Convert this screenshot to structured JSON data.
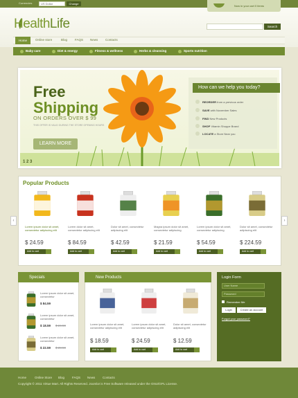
{
  "topbar": {
    "currencies_label": "Currencies",
    "currency_value": "US Dollar",
    "change_label": "Change",
    "cart_text": "Now in your cart 0 items"
  },
  "header": {
    "logo_part1": "Health",
    "logo_part2": "Life",
    "search_label": "Search"
  },
  "nav": [
    "Home",
    "Online store",
    "Blog",
    "FAQS",
    "News",
    "Contacts"
  ],
  "categories": [
    "Baby care",
    "Diet & energy",
    "Fitness & wellness",
    "Herbs & cleansing",
    "Sports nutrition"
  ],
  "banner": {
    "title1": "Free",
    "title2": "Shipping",
    "orders": "ON ORDERS OVER $ 99",
    "small": "THIS OFFER IS VALID DURING THE STORE OPENING HOURS",
    "learn_more": "LEARN MORE",
    "pager": "1 2 3",
    "help_title": "How can we help you today?",
    "help_items": [
      {
        "bold": "REORDER",
        "text": "from a previous order"
      },
      {
        "bold": "SAVE",
        "text": "with November Sales"
      },
      {
        "bold": "FIND",
        "text": "New Products"
      },
      {
        "bold": "SHOP",
        "text": "Vitamin Shoppe Brand"
      },
      {
        "bold": "LOCATE",
        "text": "a Store Near you"
      }
    ]
  },
  "popular": {
    "title": "Popular Products",
    "products": [
      {
        "desc": "Lorem ipsum dolor sit amet, consectetur adipiscing elit",
        "price": "$ 24.59",
        "green": true
      },
      {
        "desc": "Lorem dolor sit amet, consectetur adipiscing elit",
        "price": "$ 84.59",
        "green": false
      },
      {
        "desc": "Dolor sit amet, consectetur adipiscing elit",
        "price": "$ 42.59",
        "green": false
      },
      {
        "desc": "Magna ipsum dolor sit amet, consectetur adipiscing",
        "price": "$ 21.59",
        "green": false
      },
      {
        "desc": "Lorem ipsum dolor sit amet, consectetur adipiscing",
        "price": "$ 54.59",
        "green": false
      },
      {
        "desc": "Dolor sit amet, consectetur adipiscing elit",
        "price": "$ 224.59",
        "green": false
      }
    ],
    "add_to_cart": "Add to cart",
    "prev_arrow": "‹",
    "next_arrow": "›"
  },
  "specials": {
    "title": "Specials",
    "items": [
      {
        "desc": "Lorem ipsum dolor sit amet, consectetur",
        "price": "$ 84.59",
        "old": ""
      },
      {
        "desc": "Lorem ipsum dolor sit amet, consectetur",
        "price": "$ 18.59",
        "old": "$ 24.59"
      },
      {
        "desc": "Lorem ipsum dolor sit amet, consectetur",
        "price": "$ 22.59",
        "old": "$ 28.59"
      }
    ]
  },
  "new_products": {
    "title": "New Products",
    "products": [
      {
        "desc": "Lorem ipsum dolor sit amet, consectetur adipiscing elit",
        "price": "$ 18.59"
      },
      {
        "desc": "Lorem ipsum dolor sit amet, consectetur adipiscing elit",
        "price": "$ 24.59"
      },
      {
        "desc": "Dolor sit amet, consectetur adipiscing elit",
        "price": "$ 12.59"
      }
    ],
    "add_to_cart": "Add to cart"
  },
  "login": {
    "title": "Login Form",
    "username_placeholder": "User Name",
    "password_placeholder": "Password",
    "remember": "Remember Me",
    "login_btn": "Login",
    "create_btn": "Create an account",
    "forgot": "Forgot your password?"
  },
  "footer": {
    "links": [
      "Home",
      "Online Store",
      "Blog",
      "FAQS",
      "News",
      "Contacts"
    ],
    "copyright": "Copyright © 2011 Virtue Mart. All Rights Reserved. Joomla! is Free Software released under the GNU/GPL License."
  }
}
